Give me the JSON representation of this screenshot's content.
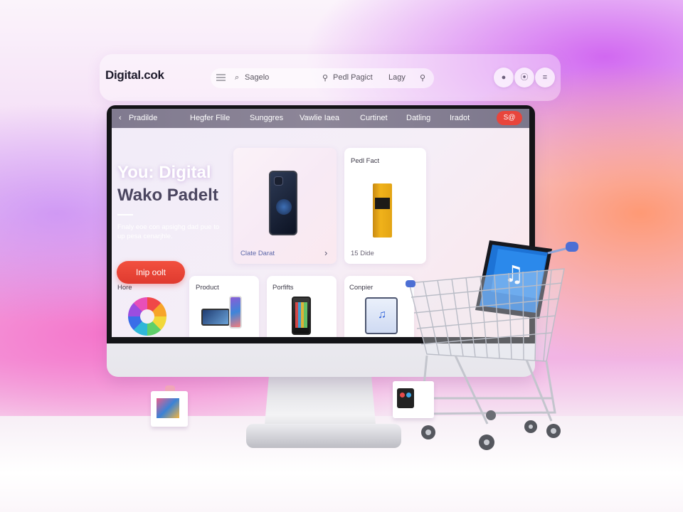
{
  "brand": "Digital.cok",
  "topbar": {
    "menu_icon": "hamburger-menu-icon",
    "search_label": "Sagelo",
    "search_placeholder": "Pedl Pagict",
    "link": "Lagy",
    "actions": [
      "notification-icon",
      "cart-icon",
      "menu-dots-icon"
    ]
  },
  "screen": {
    "nav": {
      "back": "Pradilde",
      "items": [
        "Hegfer Flile",
        "Sunggres",
        "Vawlie Iaea",
        "Curtinet",
        "Datling",
        "Iradot"
      ],
      "cta": "S@"
    },
    "hero": {
      "title_line1": "You: Digital",
      "title_line2": "Wako Padelt",
      "description": "Fnaly eoe con apsighg dad pue to up pesa cenarjhle.",
      "button": "Inip oolt"
    },
    "featured_card": {
      "label": "Clate Darat"
    },
    "product_card": {
      "title": "Pedl Fact",
      "footer": "15 Dide"
    },
    "categories": [
      {
        "label": "Hore"
      },
      {
        "label": "Product"
      },
      {
        "label": "Porfifts"
      },
      {
        "label": "Conpier"
      }
    ]
  },
  "colors": {
    "accent": "#e8453c",
    "nav_bar": "#847e93",
    "title_dark": "#4b4660",
    "screen_bg": "#f3edf8"
  }
}
